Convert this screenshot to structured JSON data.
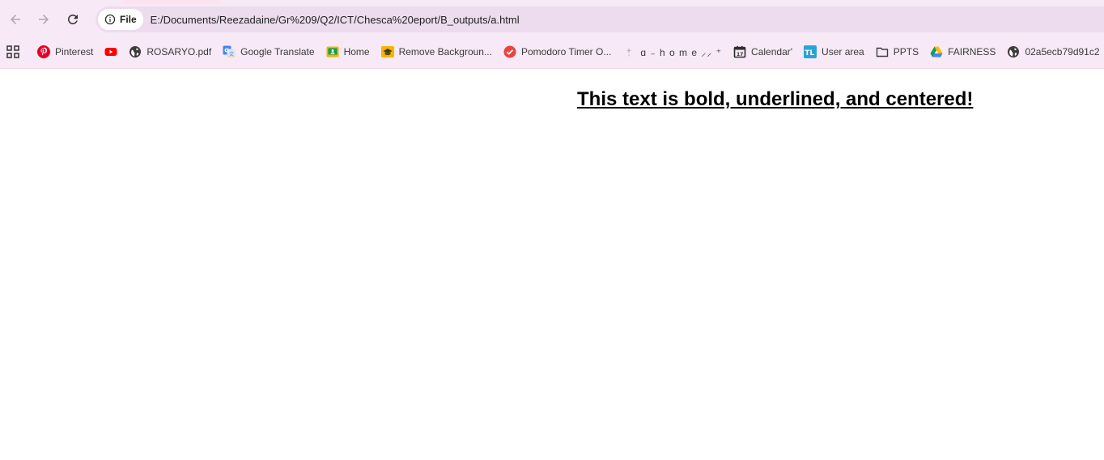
{
  "browser": {
    "site_chip_label": "File",
    "url": "E:/Documents/Reezadaine/Gr%209/Q2/ICT/Chesca%20eport/B_outputs/a.html",
    "nav": {
      "back_icon": "arrow-left-icon",
      "forward_icon": "arrow-right-icon",
      "reload_icon": "reload-icon"
    }
  },
  "bookmarks": [
    {
      "label": "Pinterest",
      "icon": "pinterest-icon",
      "color": "#e60023"
    },
    {
      "label": "",
      "icon": "youtube-icon",
      "color": "#ff0000"
    },
    {
      "label": "ROSARYO.pdf",
      "icon": "globe-icon",
      "color": "#3c3c3c"
    },
    {
      "label": "Google Translate",
      "icon": "google-translate-icon",
      "color": "#4285f4"
    },
    {
      "label": "Home",
      "icon": "classroom-icon",
      "color": "#f4b400"
    },
    {
      "label": "Remove Backgroun...",
      "icon": "graduation-cap-icon",
      "color": "#f4b400"
    },
    {
      "label": "Pomodoro Timer O...",
      "icon": "check-circle-icon",
      "color": "#e8453c"
    },
    {
      "label": "ɑ ₋ h o m e ⸝⸝ ⁺",
      "icon": "sparkle-icon",
      "color": "#9e9e9e"
    },
    {
      "label": "Calendar'",
      "icon": "calendar-icon",
      "color": "#3c3c3c"
    },
    {
      "label": "User area",
      "icon": "tl-icon",
      "color": "#2aa2d6"
    },
    {
      "label": "PPTS",
      "icon": "folder-icon",
      "color": "#3c3c3c"
    },
    {
      "label": "FAIRNESS",
      "icon": "google-drive-icon",
      "color": "#0f9d58"
    },
    {
      "label": "02a5ecb79d91c2",
      "icon": "globe-icon",
      "color": "#3c3c3c"
    }
  ],
  "page": {
    "heading": "This text is bold, underlined, and centered!"
  }
}
